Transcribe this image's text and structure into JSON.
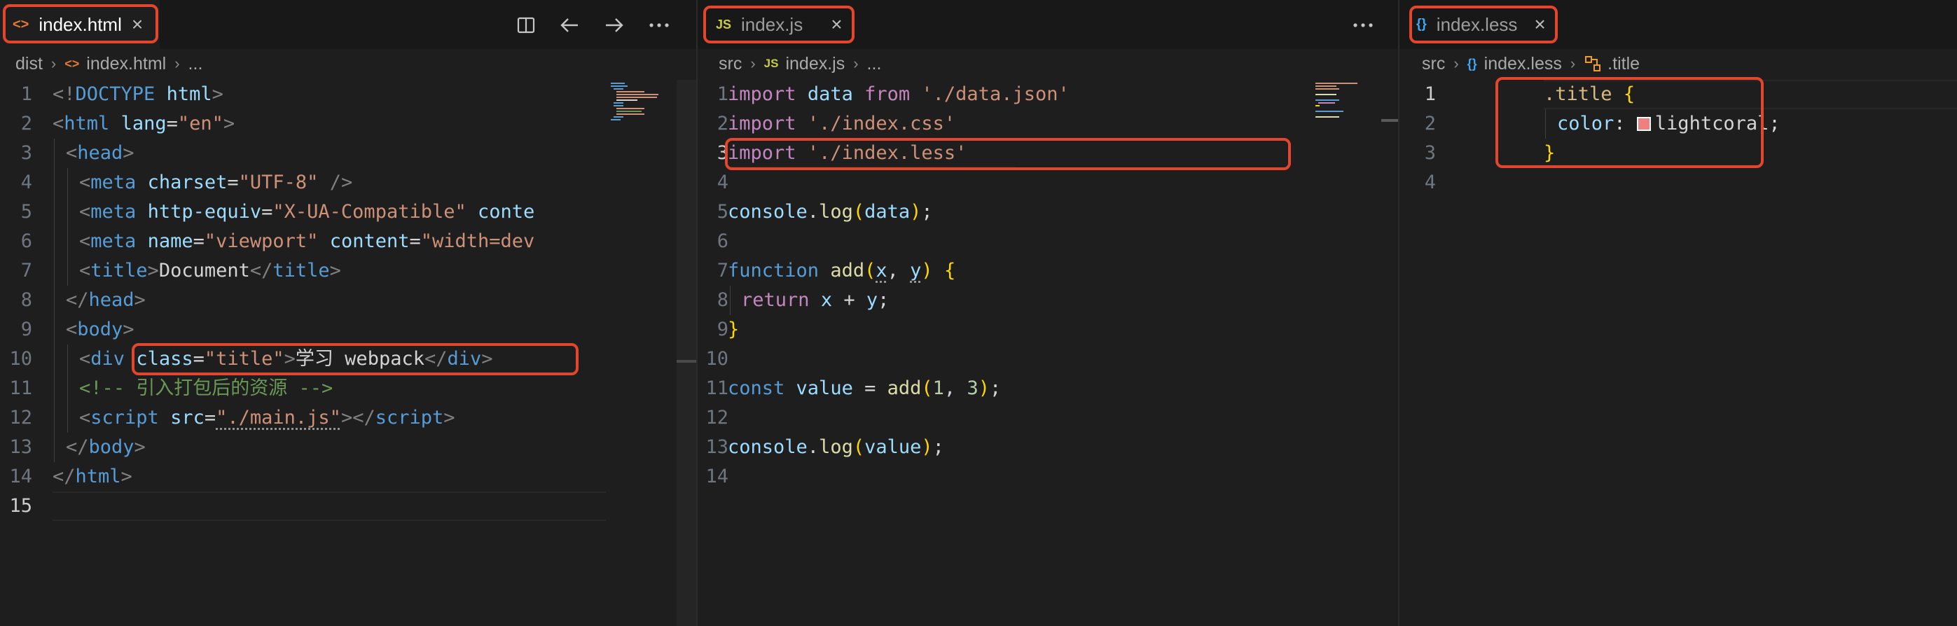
{
  "pane1": {
    "tab": {
      "icon": "<>",
      "name": "index.html",
      "close": "×"
    },
    "actions": [
      "split-editor-icon",
      "go-back-icon",
      "go-forward-icon",
      "more-actions-icon"
    ],
    "breadcrumb": {
      "folder": "dist",
      "file": "index.html",
      "rest": "..."
    },
    "line_numbers": [
      "1",
      "2",
      "3",
      "4",
      "5",
      "6",
      "7",
      "8",
      "9",
      "10",
      "11",
      "12",
      "13",
      "14",
      "15"
    ],
    "lines": [
      [
        [
          "tg",
          "<!"
        ],
        [
          "tn",
          "DOCTYPE"
        ],
        [
          "tx",
          " "
        ],
        [
          "at",
          "html"
        ],
        [
          "tg",
          ">"
        ]
      ],
      [
        [
          "tg",
          "<"
        ],
        [
          "tn",
          "html"
        ],
        [
          "tx",
          " "
        ],
        [
          "at",
          "lang"
        ],
        [
          "tx",
          "="
        ],
        [
          "st",
          "\"en\""
        ],
        [
          "tg",
          ">"
        ]
      ],
      [
        [
          "tg",
          "<"
        ],
        [
          "tn",
          "head"
        ],
        [
          "tg",
          ">"
        ]
      ],
      [
        [
          "tg",
          "<"
        ],
        [
          "tn",
          "meta"
        ],
        [
          "tx",
          " "
        ],
        [
          "at",
          "charset"
        ],
        [
          "tx",
          "="
        ],
        [
          "st",
          "\"UTF-8\""
        ],
        [
          "tx",
          " "
        ],
        [
          "tg",
          "/>"
        ]
      ],
      [
        [
          "tg",
          "<"
        ],
        [
          "tn",
          "meta"
        ],
        [
          "tx",
          " "
        ],
        [
          "at",
          "http-equiv"
        ],
        [
          "tx",
          "="
        ],
        [
          "st",
          "\"X-UA-Compatible\""
        ],
        [
          "tx",
          " "
        ],
        [
          "at",
          "conte"
        ]
      ],
      [
        [
          "tg",
          "<"
        ],
        [
          "tn",
          "meta"
        ],
        [
          "tx",
          " "
        ],
        [
          "at",
          "name"
        ],
        [
          "tx",
          "="
        ],
        [
          "st",
          "\"viewport\""
        ],
        [
          "tx",
          " "
        ],
        [
          "at",
          "content"
        ],
        [
          "tx",
          "="
        ],
        [
          "st",
          "\"width=dev"
        ]
      ],
      [
        [
          "tg",
          "<"
        ],
        [
          "tn",
          "title"
        ],
        [
          "tg",
          ">"
        ],
        [
          "tx",
          "Document"
        ],
        [
          "tg",
          "</"
        ],
        [
          "tn",
          "title"
        ],
        [
          "tg",
          ">"
        ]
      ],
      [
        [
          "tg",
          "</"
        ],
        [
          "tn",
          "head"
        ],
        [
          "tg",
          ">"
        ]
      ],
      [
        [
          "tg",
          "<"
        ],
        [
          "tn",
          "body"
        ],
        [
          "tg",
          ">"
        ]
      ],
      [
        [
          "tg",
          "<"
        ],
        [
          "tn",
          "div"
        ],
        [
          "tx",
          " "
        ],
        [
          "at",
          "class"
        ],
        [
          "tx",
          "="
        ],
        [
          "st",
          "\"title\""
        ],
        [
          "tg",
          ">"
        ],
        [
          "tx",
          "学习 webpack"
        ],
        [
          "tg",
          "</"
        ],
        [
          "tn",
          "div"
        ],
        [
          "tg",
          ">"
        ]
      ],
      [
        [
          "cm",
          "<!-- 引入打包后的资源 -->"
        ]
      ],
      [
        [
          "tg",
          "<"
        ],
        [
          "tn",
          "script"
        ],
        [
          "tx",
          " "
        ],
        [
          "at",
          "src"
        ],
        [
          "tx",
          "="
        ],
        [
          "st",
          "\"./main.js\""
        ],
        [
          "tg",
          "></"
        ],
        [
          "tn",
          "script"
        ],
        [
          "tg",
          ">"
        ]
      ],
      [
        [
          "tg",
          "</"
        ],
        [
          "tn",
          "body"
        ],
        [
          "tg",
          ">"
        ]
      ],
      [
        [
          "tg",
          "</"
        ],
        [
          "tn",
          "html"
        ],
        [
          "tg",
          ">"
        ]
      ],
      []
    ]
  },
  "pane2": {
    "tab": {
      "icon": "JS",
      "name": "index.js",
      "close": "×"
    },
    "actions": [
      "more-actions-icon"
    ],
    "breadcrumb": {
      "folder": "src",
      "file_icon": "JS",
      "file": "index.js",
      "rest": "..."
    },
    "line_numbers": [
      "1",
      "2",
      "3",
      "4",
      "5",
      "6",
      "7",
      "8",
      "9",
      "10",
      "11",
      "12",
      "13",
      "14"
    ],
    "lines": [
      [
        [
          "kw",
          "import"
        ],
        [
          "tx",
          " "
        ],
        [
          "vr",
          "data"
        ],
        [
          "tx",
          " "
        ],
        [
          "kw",
          "from"
        ],
        [
          "tx",
          " "
        ],
        [
          "st",
          "'./data.json'"
        ]
      ],
      [
        [
          "kw",
          "import"
        ],
        [
          "tx",
          " "
        ],
        [
          "st",
          "'./index.css'"
        ]
      ],
      [
        [
          "kw",
          "import"
        ],
        [
          "tx",
          " "
        ],
        [
          "st",
          "'./index.less'"
        ]
      ],
      [],
      [
        [
          "vr",
          "console"
        ],
        [
          "tx",
          "."
        ],
        [
          "fn",
          "log"
        ],
        [
          "b1",
          "("
        ],
        [
          "vr",
          "data"
        ],
        [
          "b1",
          ")"
        ],
        [
          "tx",
          ";"
        ]
      ],
      [],
      [
        [
          "tn",
          "function"
        ],
        [
          "tx",
          " "
        ],
        [
          "fn",
          "add"
        ],
        [
          "b1",
          "("
        ],
        [
          "vr",
          "x"
        ],
        [
          "tx",
          ", "
        ],
        [
          "vr",
          "y"
        ],
        [
          "b1",
          ")"
        ],
        [
          "tx",
          " "
        ],
        [
          "b1",
          "{"
        ]
      ],
      [
        [
          "kw",
          "return"
        ],
        [
          "tx",
          " "
        ],
        [
          "vr",
          "x"
        ],
        [
          "tx",
          " + "
        ],
        [
          "vr",
          "y"
        ],
        [
          "tx",
          ";"
        ]
      ],
      [
        [
          "b1",
          "}"
        ]
      ],
      [],
      [
        [
          "tn",
          "const"
        ],
        [
          "tx",
          " "
        ],
        [
          "vr",
          "value"
        ],
        [
          "tx",
          " = "
        ],
        [
          "fn",
          "add"
        ],
        [
          "b1",
          "("
        ],
        [
          "nm",
          "1"
        ],
        [
          "tx",
          ", "
        ],
        [
          "nm",
          "3"
        ],
        [
          "b1",
          ")"
        ],
        [
          "tx",
          ";"
        ]
      ],
      [],
      [
        [
          "vr",
          "console"
        ],
        [
          "tx",
          "."
        ],
        [
          "fn",
          "log"
        ],
        [
          "b1",
          "("
        ],
        [
          "vr",
          "value"
        ],
        [
          "b1",
          ")"
        ],
        [
          "tx",
          ";"
        ]
      ],
      []
    ]
  },
  "pane3": {
    "tab": {
      "icon": "{}",
      "name": "index.less",
      "close": "×"
    },
    "breadcrumb": {
      "folder": "src",
      "file_icon": "{}",
      "file": "index.less",
      "symbol": ".title"
    },
    "line_numbers": [
      "1",
      "2",
      "3",
      "4"
    ],
    "lines": [
      [
        [
          "sel",
          ".title"
        ],
        [
          "tx",
          " "
        ],
        [
          "b1",
          "{"
        ]
      ],
      [
        [
          "pr",
          "color"
        ],
        [
          "tx",
          ": "
        ],
        [
          "sw",
          ""
        ],
        [
          "tx",
          "lightcoral;"
        ]
      ],
      [
        [
          "b1",
          "}"
        ]
      ],
      []
    ]
  },
  "colors": {
    "highlight": "#e3452d",
    "swatch": "#f08080"
  }
}
